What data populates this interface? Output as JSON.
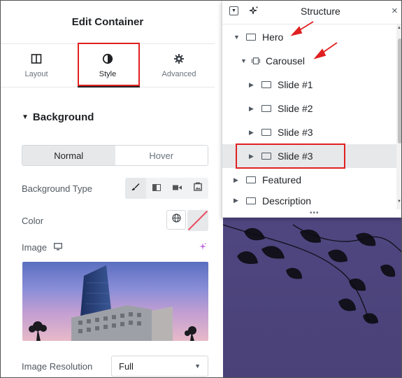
{
  "panel": {
    "title": "Edit Container",
    "tabs": [
      {
        "label": "Layout",
        "icon": "layout-columns-icon"
      },
      {
        "label": "Style",
        "icon": "half-circle-contrast-icon"
      },
      {
        "label": "Advanced",
        "icon": "gear-icon"
      }
    ],
    "section": "Background",
    "toggle": {
      "normal": "Normal",
      "hover": "Hover"
    },
    "background_type_label": "Background Type",
    "color_label": "Color",
    "image_label": "Image",
    "resolution_label": "Image Resolution",
    "resolution_value": "Full"
  },
  "structure": {
    "title": "Structure",
    "items": [
      {
        "label": "Hero"
      },
      {
        "label": "Carousel"
      },
      {
        "label": "Slide #1"
      },
      {
        "label": "Slide #2"
      },
      {
        "label": "Slide #3"
      },
      {
        "label": "Slide #3"
      },
      {
        "label": "Featured"
      },
      {
        "label": "Description"
      }
    ]
  },
  "colors": {
    "highlight": "#e02020",
    "accent_ai": "#c36de0",
    "annotation_arrow": "#e02020"
  }
}
